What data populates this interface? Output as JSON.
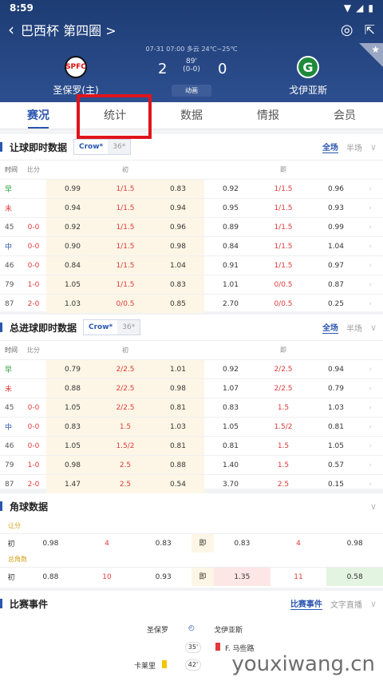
{
  "status": {
    "time": "8:59"
  },
  "header": {
    "title": "巴西杯 第四圈",
    "chevron": ">"
  },
  "match": {
    "datetime": "07-31 07:00  多云 24℃~25℃",
    "home": "圣保罗(主)",
    "away": "戈伊亚斯",
    "home_score": "2",
    "away_score": "0",
    "minute": "89'",
    "halftime": "(0-0)",
    "animation": "动画"
  },
  "tabs": [
    "赛况",
    "统计",
    "数据",
    "情报",
    "会员"
  ],
  "handicap": {
    "title": "让球即时数据",
    "book1": "Crow*",
    "book2": "36*",
    "all": "全场",
    "half": "半场",
    "cols": {
      "time": "时间",
      "score": "比分",
      "early": "初",
      "live": "即"
    },
    "rows": [
      {
        "t": "早",
        "s": "",
        "v": [
          "0.99",
          "1/1.5",
          "0.83",
          "0.92",
          "1/1.5",
          "0.96"
        ]
      },
      {
        "t": "未",
        "s": "",
        "v": [
          "0.94",
          "1/1.5",
          "0.94",
          "0.95",
          "1/1.5",
          "0.93"
        ]
      },
      {
        "t": "45",
        "s": "0-0",
        "v": [
          "0.92",
          "1/1.5",
          "0.96",
          "0.89",
          "1/1.5",
          "0.99"
        ]
      },
      {
        "t": "中",
        "s": "0-0",
        "v": [
          "0.90",
          "1/1.5",
          "0.98",
          "0.84",
          "1/1.5",
          "1.04"
        ]
      },
      {
        "t": "46",
        "s": "0-0",
        "v": [
          "0.84",
          "1/1.5",
          "1.04",
          "0.91",
          "1/1.5",
          "0.97"
        ]
      },
      {
        "t": "79",
        "s": "1-0",
        "v": [
          "1.05",
          "1/1.5",
          "0.83",
          "1.01",
          "0/0.5",
          "0.87"
        ]
      },
      {
        "t": "87",
        "s": "2-0",
        "v": [
          "1.03",
          "0/0.5",
          "0.85",
          "2.70",
          "0/0.5",
          "0.25"
        ]
      }
    ]
  },
  "total": {
    "title": "总进球即时数据",
    "book1": "Crow*",
    "book2": "36*",
    "all": "全场",
    "half": "半场",
    "cols": {
      "time": "时间",
      "score": "比分",
      "early": "初",
      "live": "即"
    },
    "rows": [
      {
        "t": "早",
        "s": "",
        "v": [
          "0.79",
          "2/2.5",
          "1.01",
          "0.92",
          "2/2.5",
          "0.94"
        ]
      },
      {
        "t": "未",
        "s": "",
        "v": [
          "0.88",
          "2/2.5",
          "0.98",
          "1.07",
          "2/2.5",
          "0.79"
        ]
      },
      {
        "t": "45",
        "s": "0-0",
        "v": [
          "1.05",
          "2/2.5",
          "0.81",
          "0.83",
          "1.5",
          "1.03"
        ]
      },
      {
        "t": "中",
        "s": "0-0",
        "v": [
          "0.83",
          "1.5",
          "1.03",
          "1.05",
          "1.5/2",
          "0.81"
        ]
      },
      {
        "t": "46",
        "s": "0-0",
        "v": [
          "1.05",
          "1.5/2",
          "0.81",
          "0.81",
          "1.5",
          "1.05"
        ]
      },
      {
        "t": "79",
        "s": "1-0",
        "v": [
          "0.98",
          "2.5",
          "0.88",
          "1.40",
          "1.5",
          "0.57"
        ]
      },
      {
        "t": "87",
        "s": "2-0",
        "v": [
          "1.47",
          "2.5",
          "0.54",
          "3.70",
          "2.5",
          "0.15"
        ]
      }
    ]
  },
  "corners": {
    "title": "角球数据",
    "handicap_label": "让分",
    "total_label": "总角数",
    "early": "初",
    "live": "即",
    "handicap": [
      "0.98",
      "4",
      "0.83",
      "0.83",
      "4",
      "0.98"
    ],
    "total": [
      "0.88",
      "10",
      "0.93",
      "1.35",
      "11",
      "0.58"
    ]
  },
  "events": {
    "title": "比赛事件",
    "tab1": "比赛事件",
    "tab2": "文字直播",
    "home": "圣保罗",
    "away": "戈伊亚斯",
    "e1": {
      "minute": "35'",
      "player": "F. 马些路"
    },
    "e2": {
      "minute": "42'",
      "player": "卡莱里"
    }
  },
  "watermark": "youxiwang.cn"
}
